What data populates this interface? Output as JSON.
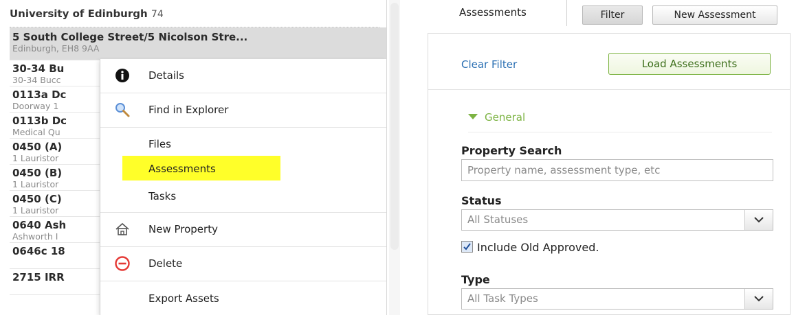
{
  "left_pane": {
    "header": {
      "title": "University of Edinburgh",
      "count": "74"
    },
    "items": [
      {
        "title": "5 South College Street/5 Nicolson Stre...",
        "subtitle": "Edinburgh, EH8 9AA",
        "selected": true
      },
      {
        "title": "30-34 Bu",
        "subtitle": "30-34 Bucc"
      },
      {
        "title": "0113a Dc",
        "subtitle": "Doorway 1"
      },
      {
        "title": "0113b Dc",
        "subtitle": "Medical Qu"
      },
      {
        "title": "0450 (A)",
        "subtitle": "1 Lauristor"
      },
      {
        "title": "0450 (B)",
        "subtitle": "1 Lauristor"
      },
      {
        "title": "0450 (C)",
        "subtitle": "1 Lauristor"
      },
      {
        "title": "0640 Ash",
        "subtitle": "Ashworth I"
      },
      {
        "title": "0646c 18",
        "subtitle": ""
      },
      {
        "title": "2715 IRR",
        "subtitle": ""
      }
    ]
  },
  "context_menu": {
    "items": [
      {
        "label": "Details",
        "icon": "info-icon"
      },
      {
        "label": "Find in Explorer",
        "icon": "magnifier-icon"
      },
      {
        "label": "Files",
        "icon": ""
      },
      {
        "label": "Assessments",
        "icon": "",
        "highlighted": true
      },
      {
        "label": "Tasks",
        "icon": ""
      },
      {
        "label": "New Property",
        "icon": "house-icon"
      },
      {
        "label": "Delete",
        "icon": "minus-circle-icon"
      },
      {
        "label": "Export Assets",
        "icon": ""
      }
    ]
  },
  "tabs": {
    "active_label": "Assessments",
    "filter_label": "Filter",
    "new_label": "New Assessment"
  },
  "filter_panel": {
    "clear_filter": "Clear Filter",
    "load_button": "Load Assessments",
    "section_title": "General",
    "property_search": {
      "label": "Property Search",
      "placeholder": "Property name, assessment type, etc"
    },
    "status": {
      "label": "Status",
      "selected": "All Statuses"
    },
    "include_old": {
      "label": "Include Old Approved.",
      "checked": true
    },
    "type": {
      "label": "Type",
      "selected": "All Task Types"
    }
  },
  "colors": {
    "highlight": "#ffff29",
    "link": "#2a6fb3",
    "accent_green": "#7cb342",
    "delete_red": "#e53935"
  }
}
